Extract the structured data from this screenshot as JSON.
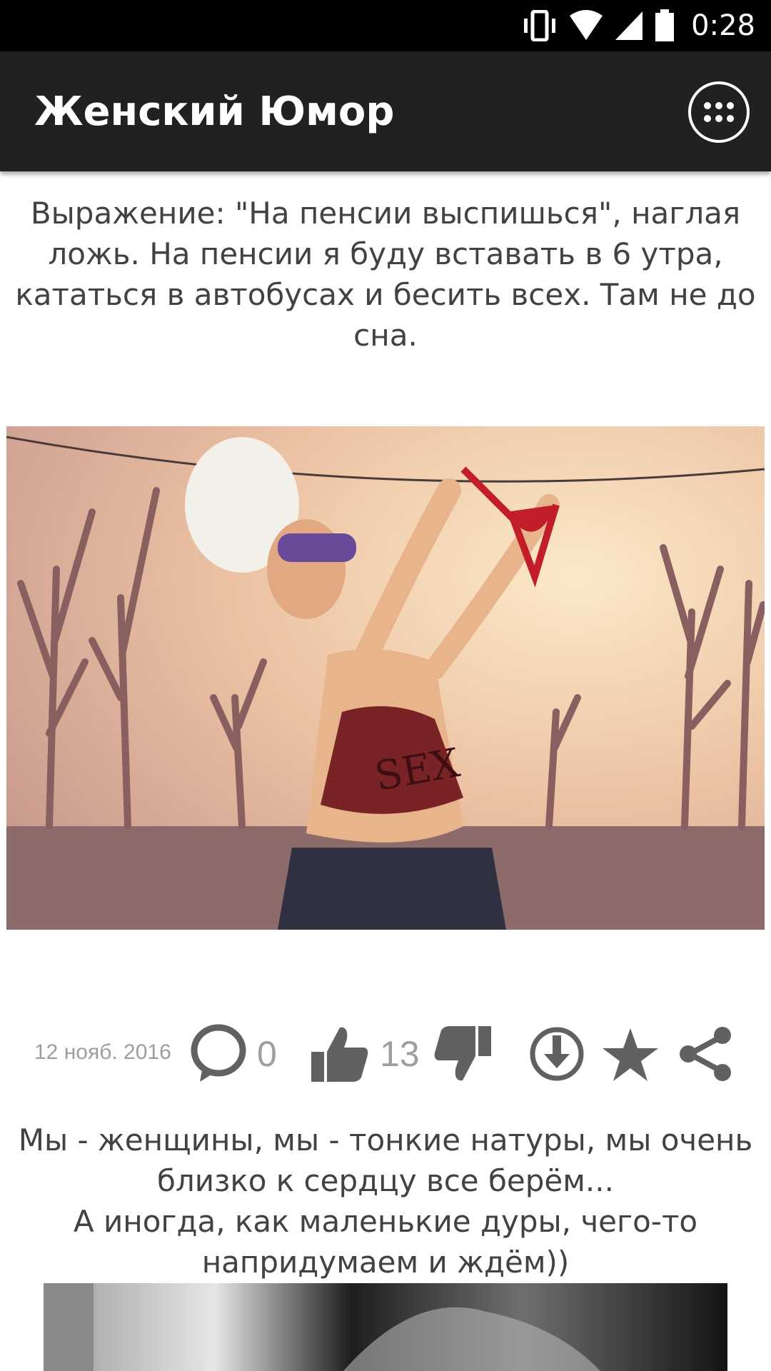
{
  "status_bar": {
    "time": "0:28",
    "icons": [
      "vibrate-icon",
      "wifi-icon",
      "signal-icon",
      "battery-icon"
    ]
  },
  "app_bar": {
    "title": "Женский Юмор",
    "menu_icon": "apps-grid-icon"
  },
  "posts": [
    {
      "text": "Выражение: \"На пенсии выспишься\", наглая ложь. На пенсии я буду вставать в 6 утра, кататься в автобусах и бесить всех. Там не до сна.",
      "image": "illustration",
      "image_text": "SEX",
      "date": "12 нояб. 2016",
      "comments": "0",
      "likes": "13",
      "actions": [
        "comment-icon",
        "thumbs-up-icon",
        "thumbs-down-icon",
        "download-icon",
        "star-icon",
        "share-icon"
      ]
    },
    {
      "text_line1": "Мы - женщины, мы - тонкие натуры, мы очень близко к сердцу все берём...",
      "text_line2": "А иногда, как маленькие дуры, чего-то напридумаем и ждём))",
      "image": "photo"
    }
  ],
  "colors": {
    "status_bar": "#000000",
    "app_bar": "#212121",
    "text": "#424242",
    "icon_gray": "#9e9e9e",
    "icon_dark": "#616161"
  }
}
